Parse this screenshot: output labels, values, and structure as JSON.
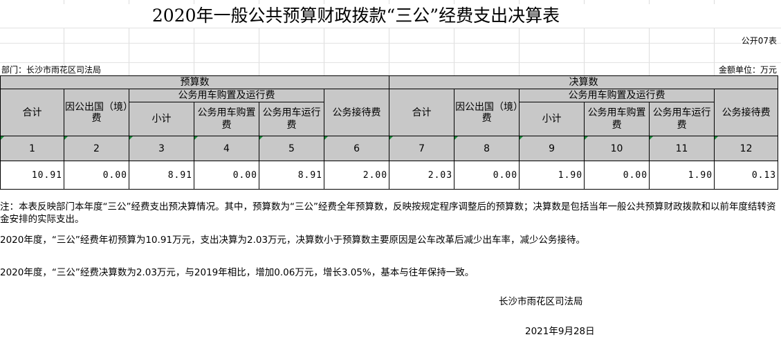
{
  "title": "2020年一般公共预算财政拨款“三公”经费支出决算表",
  "form_code": "公开07表",
  "department": "部门：长沙市雨花区司法局",
  "unit": "金额单位：万元",
  "groups": {
    "budget": "预算数",
    "final": "决算数"
  },
  "subgroup": "公务用车购置及运行费",
  "columns": {
    "total": "合计",
    "abroad": "因公出国（境）费",
    "subtotal": "小计",
    "purchase": "公务用车购置费",
    "operation": "公务用车运行费",
    "reception": "公务接待费"
  },
  "index_row": [
    "1",
    "2",
    "3",
    "4",
    "5",
    "6",
    "7",
    "8",
    "9",
    "10",
    "11",
    "12"
  ],
  "value_row": [
    "10.91",
    "0.00",
    "8.91",
    "0.00",
    "8.91",
    "2.00",
    "2.03",
    "0.00",
    "1.90",
    "0.00",
    "1.90",
    "0.13"
  ],
  "notes": [
    "注：本表反映部门本年度“三公”经费支出预决算情况。其中，预算数为“三公”经费全年预算数，反映按规定程序调整后的预算数；决算数是包括当年一般公共预算财政拨款和以前年度结转资金安排的实际支出。",
    "2020年度，“三公”经费年初预算为10.91万元，支出决算为2.03万元，决算数小于预算数主要原因是公车改革后减少出车率，减少公务接待。",
    "2020年度，“三公”经费决算数为2.03万元，与2019年相比，增加0.06万元，增长3.05%，基本与往年保持一致。"
  ],
  "signature": {
    "org": "长沙市雨花区司法局",
    "date": "2021年9月28日"
  }
}
